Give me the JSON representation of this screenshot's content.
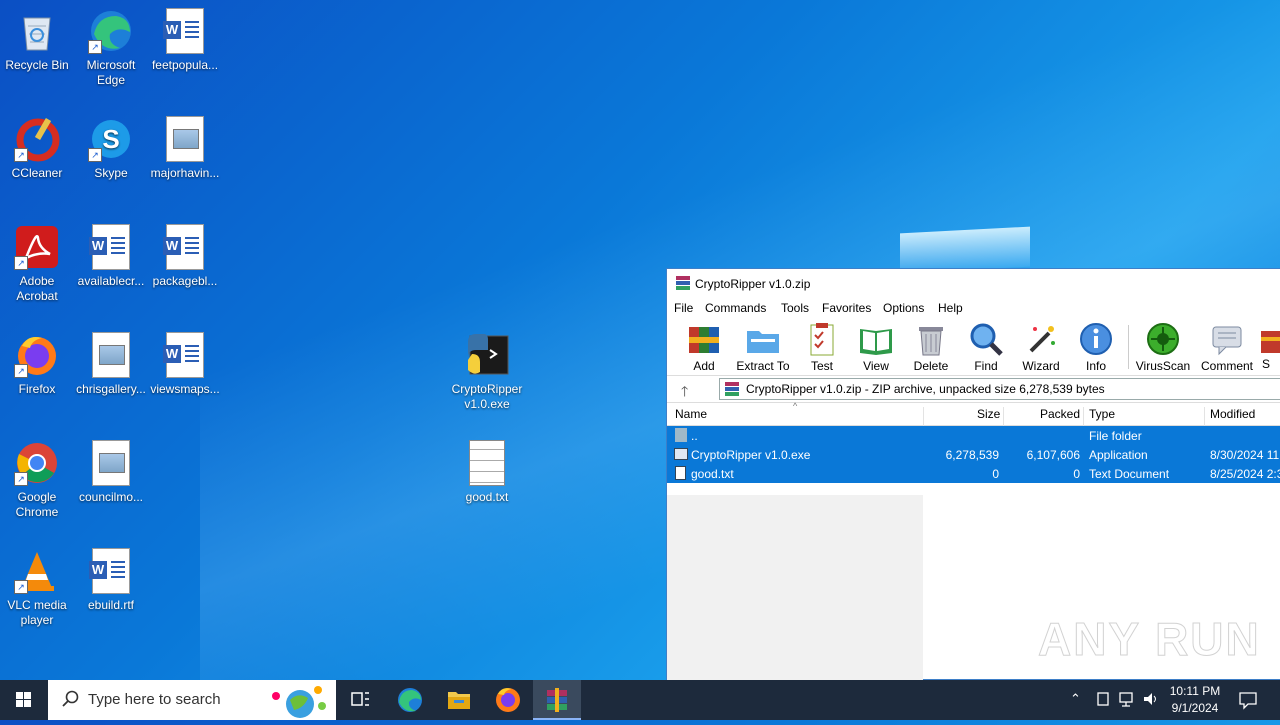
{
  "desktop": {
    "icons": [
      {
        "label": "Recycle Bin"
      },
      {
        "label": "Microsoft Edge"
      },
      {
        "label": "feetpopula..."
      },
      {
        "label": "CCleaner"
      },
      {
        "label": "Skype"
      },
      {
        "label": "majorhavin..."
      },
      {
        "label": "Adobe Acrobat"
      },
      {
        "label": "availablecr..."
      },
      {
        "label": "packagebl..."
      },
      {
        "label": "Firefox"
      },
      {
        "label": "chrisgallery..."
      },
      {
        "label": "viewsmaps..."
      },
      {
        "label": "Google Chrome"
      },
      {
        "label": "councilmo..."
      },
      {
        "label": "VLC media player"
      },
      {
        "label": "ebuild.rtf"
      },
      {
        "label": "CryptoRipper v1.0.exe"
      },
      {
        "label": "good.txt"
      }
    ]
  },
  "winrar": {
    "title": "CryptoRipper v1.0.zip",
    "menu": [
      "File",
      "Commands",
      "Tools",
      "Favorites",
      "Options",
      "Help"
    ],
    "tools": [
      "Add",
      "Extract To",
      "Test",
      "View",
      "Delete",
      "Find",
      "Wizard",
      "Info",
      "VirusScan",
      "Comment",
      "S"
    ],
    "path": "CryptoRipper v1.0.zip - ZIP archive, unpacked size 6,278,539 bytes",
    "columns": {
      "name": "Name",
      "size": "Size",
      "packed": "Packed",
      "type": "Type",
      "modified": "Modified"
    },
    "rows": [
      {
        "name": "..",
        "size": "",
        "packed": "",
        "type": "File folder",
        "modified": ""
      },
      {
        "name": "CryptoRipper v1.0.exe",
        "size": "6,278,539",
        "packed": "6,107,606",
        "type": "Application",
        "modified": "8/30/2024 11:"
      },
      {
        "name": "good.txt",
        "size": "0",
        "packed": "0",
        "type": "Text Document",
        "modified": "8/25/2024 2:3"
      }
    ]
  },
  "taskbar": {
    "search_placeholder": "Type here to search",
    "time": "10:11 PM",
    "date": "9/1/2024"
  },
  "watermark": "ANY RUN"
}
